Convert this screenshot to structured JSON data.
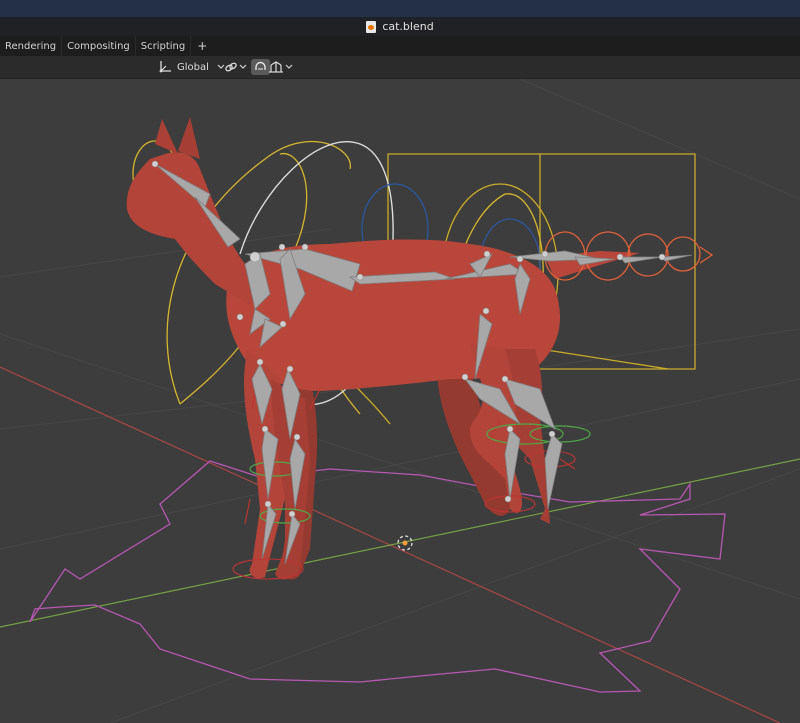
{
  "window": {
    "title": "cat.blend",
    "title_icon": "blend-file-icon"
  },
  "workspace_tabs": [
    {
      "label": "Rendering"
    },
    {
      "label": "Compositing"
    },
    {
      "label": "Scripting"
    }
  ],
  "header": {
    "transform_orientation": "Global",
    "icons": [
      "orientation-axes-icon",
      "pivot-link-icon",
      "snap-magnet-icon",
      "proportional-falloff-icon"
    ]
  },
  "colors": {
    "viewport_bg": "#3d3d3d",
    "mesh": "#b8463a",
    "bone": "#a8a8a8",
    "yellow_control": "#d4b630",
    "orange_control": "#e0613a",
    "blue_control": "#2d56a0",
    "magenta_root": "#b658b2",
    "x_axis": "#b54b4b",
    "y_axis": "#7ea64a"
  }
}
